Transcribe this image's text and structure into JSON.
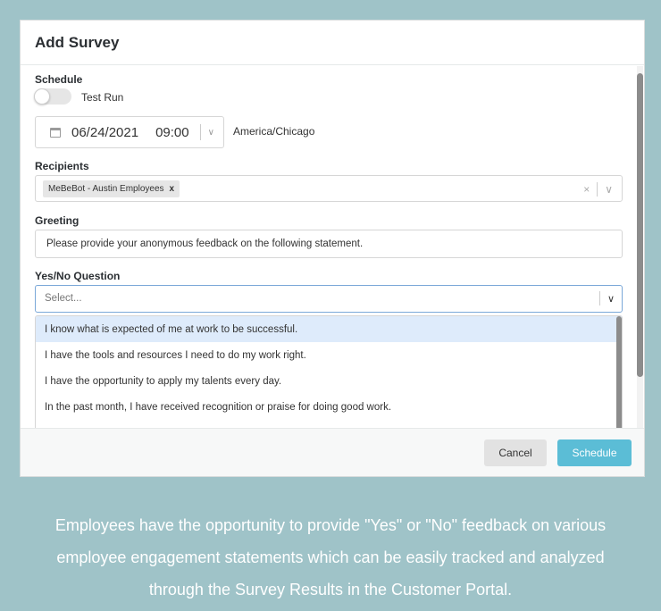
{
  "modal": {
    "title": "Add Survey",
    "schedule": {
      "label": "Schedule",
      "test_run_label": "Test Run",
      "test_run_on": false,
      "date": "06/24/2021",
      "time": "09:00",
      "timezone": "America/Chicago"
    },
    "recipients": {
      "label": "Recipients",
      "chips": [
        "MeBeBot - Austin Employees"
      ],
      "chip_remove": "x",
      "clear_glyph": "×"
    },
    "greeting": {
      "label": "Greeting",
      "value": "Please provide your anonymous feedback on the following statement."
    },
    "question": {
      "label": "Yes/No Question",
      "placeholder": "Select...",
      "options": [
        "I know what is expected of me at work to be successful.",
        "I have the tools and resources I need to do my work right.",
        "I have the opportunity to apply my talents every day.",
        "In the past month, I have received recognition or praise for doing good work."
      ]
    },
    "footer": {
      "cancel_label": "Cancel",
      "schedule_label": "Schedule"
    }
  },
  "caption": [
    "Employees have the opportunity to provide \"Yes\" or \"No\" feedback on various",
    "employee engagement statements which can be easily tracked and analyzed",
    "through the Survey Results in the Customer Portal."
  ],
  "colors": {
    "background": "#9fc3c8",
    "primary_button": "#5bbdd6",
    "highlight_option": "#deebfb"
  }
}
